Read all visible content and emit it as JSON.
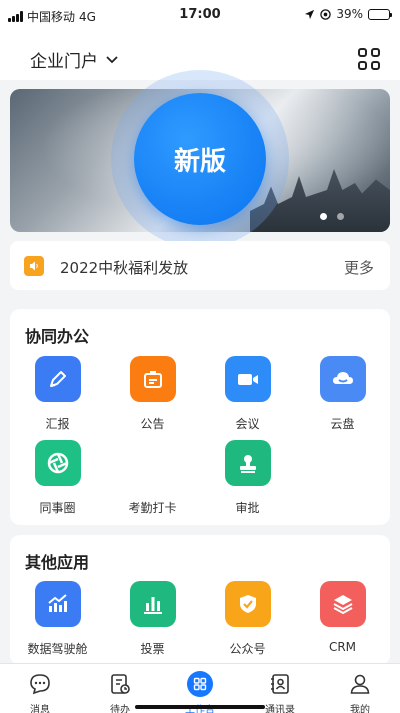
{
  "status": {
    "carrier": "中国移动",
    "network": "4G",
    "time": "17:00",
    "battery": "39%",
    "battery_level": 0.39
  },
  "header": {
    "title": "企业门户"
  },
  "banner": {
    "badge": "新版",
    "active_dot": 0,
    "dot_count": 2
  },
  "notice": {
    "text": "2022中秋福利发放",
    "more": "更多"
  },
  "sections": [
    {
      "title": "协同办公",
      "apps": [
        {
          "label": "汇报",
          "icon": "pen-icon",
          "color": "#3b7bf4"
        },
        {
          "label": "公告",
          "icon": "announcement-icon",
          "color": "#fb7d12"
        },
        {
          "label": "会议",
          "icon": "video-camera-icon",
          "color": "#2d8cf7"
        },
        {
          "label": "云盘",
          "icon": "cloud-icon",
          "color": "#4a8af4"
        },
        {
          "label": "同事圈",
          "icon": "aperture-icon",
          "color": "#1fc085"
        },
        {
          "label": "考勤打卡",
          "icon": "",
          "color": ""
        },
        {
          "label": "审批",
          "icon": "stamp-icon",
          "color": "#1fb97f"
        }
      ]
    },
    {
      "title": "其他应用",
      "apps": [
        {
          "label": "数据驾驶舱",
          "icon": "chart-trend-icon",
          "color": "#3b7bf4"
        },
        {
          "label": "投票",
          "icon": "bar-chart-icon",
          "color": "#1fb97f"
        },
        {
          "label": "公众号",
          "icon": "shield-check-icon",
          "color": "#f9a51a"
        },
        {
          "label": "CRM",
          "icon": "layers-icon",
          "color": "#f25f5c"
        }
      ]
    }
  ],
  "tabs": [
    {
      "label": "消息",
      "icon": "chat-icon"
    },
    {
      "label": "待办",
      "icon": "todo-icon"
    },
    {
      "label": "工作台",
      "icon": "workbench-icon",
      "active": true
    },
    {
      "label": "通讯录",
      "icon": "contacts-icon"
    },
    {
      "label": "我的",
      "icon": "user-icon"
    }
  ],
  "colors": {
    "accent": "#1677ff",
    "notice": "#f7a31e"
  }
}
